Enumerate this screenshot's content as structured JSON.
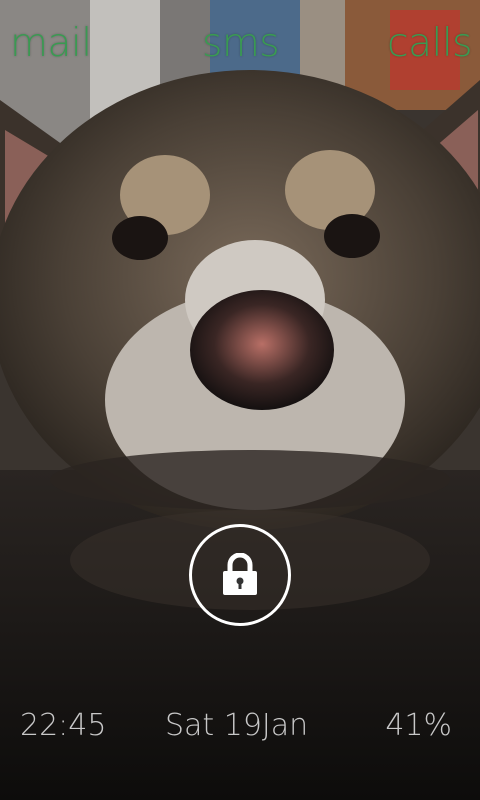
{
  "shortcuts": {
    "mail": "mail",
    "sms": "sms",
    "calls": "calls"
  },
  "status": {
    "time": "22:45",
    "date": "Sat 19Jan",
    "battery": "41%"
  },
  "icons": {
    "unlock": "lock-icon"
  },
  "colors": {
    "shortcut_text": "#3a9a52",
    "status_text": "#c8c8c8",
    "ring": "#ffffff"
  }
}
